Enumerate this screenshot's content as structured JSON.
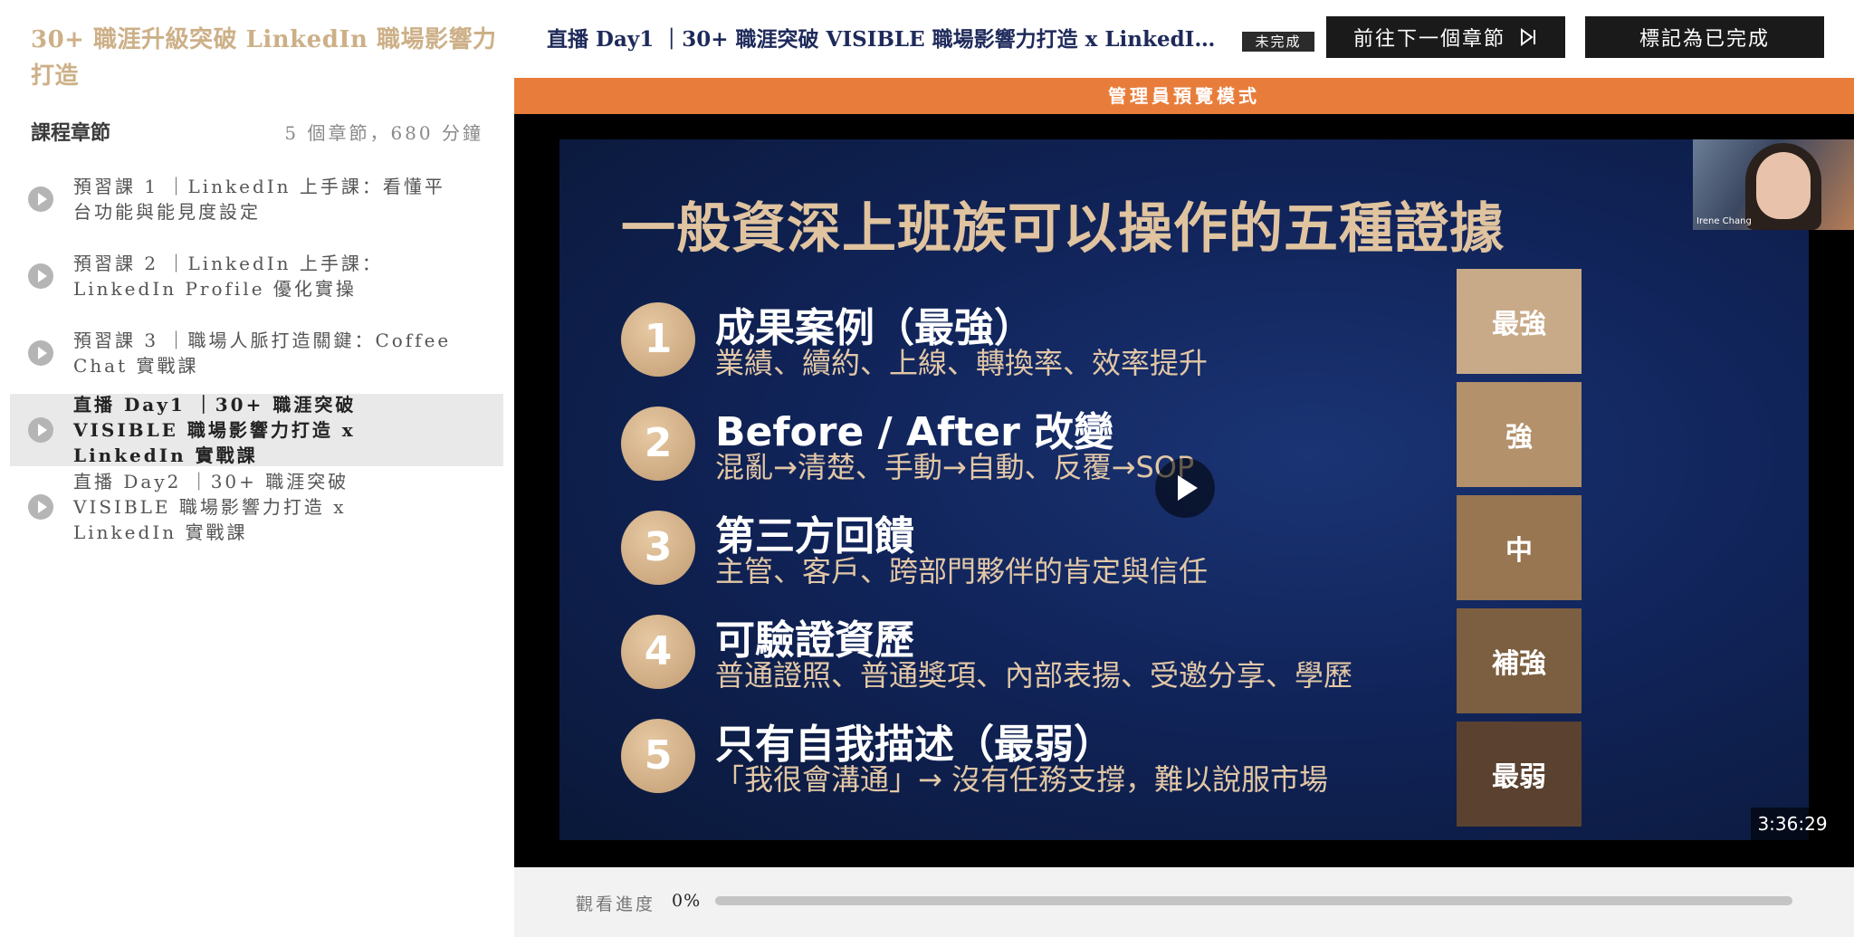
{
  "sidebar": {
    "course_title": "30+ 職涯升級突破 LinkedIn 職場影響力打造",
    "section_label": "課程章節",
    "section_meta": "5 個章節，680 分鐘",
    "chapters": [
      {
        "label": "預習課 1 ｜LinkedIn 上手課：看懂平台功能與能見度設定"
      },
      {
        "label": "預習課 2 ｜LinkedIn 上手課：LinkedIn Profile 優化實操"
      },
      {
        "label": "預習課 3 ｜職場人脈打造關鍵：Coffee Chat 實戰課"
      },
      {
        "label": "直播 Day1 ｜30+ 職涯突破 VISIBLE 職場影響力打造 x LinkedIn 實戰課",
        "active": true
      },
      {
        "label": "直播 Day2 ｜30+ 職涯突破 VISIBLE 職場影響力打造 x LinkedIn 實戰課"
      }
    ]
  },
  "header": {
    "lesson_title": "直播 Day1 ｜30+ 職涯突破 VISIBLE 職場影響力打造 x LinkedIn 實戰課",
    "status_badge": "未完成",
    "next_button": "前往下一個章節",
    "complete_button": "標記為已完成"
  },
  "admin_banner": "管理員預覽模式",
  "slide": {
    "title": "一般資深上班族可以操作的五種證據",
    "items": [
      {
        "num": "1",
        "head": "成果案例（最強）",
        "sub": "業績、續約、上線、轉換率、效率提升",
        "level": "最強",
        "color": "#c8aa88"
      },
      {
        "num": "2",
        "head": "Before / After 改變",
        "sub": "混亂→清楚、手動→自動、反覆→SOP",
        "level": "強",
        "color": "#b3916b"
      },
      {
        "num": "3",
        "head": "第三方回饋",
        "sub": "主管、客戶、跨部門夥伴的肯定與信任",
        "level": "中",
        "color": "#987652"
      },
      {
        "num": "4",
        "head": "可驗證資歷",
        "sub": "普通證照、普通獎項、內部表揚、受邀分享、學歷",
        "level": "補強",
        "color": "#7c5e40"
      },
      {
        "num": "5",
        "head": "只有自我描述（最弱）",
        "sub": "「我很會溝通」→ 沒有任務支撐，難以說服市場",
        "level": "最弱",
        "color": "#5b4230"
      }
    ]
  },
  "webcam": {
    "name": "Irene Chang"
  },
  "video_time": "3:36:29",
  "progress": {
    "label": "觀看進度",
    "value_text": "0%",
    "fraction": 0
  },
  "icons": {
    "play": "play-icon",
    "skip_next": "skip-next-icon"
  },
  "colors": {
    "accent": "#e87d3b",
    "title_gold": "#cdb088",
    "slide_bg": "#11245a"
  }
}
